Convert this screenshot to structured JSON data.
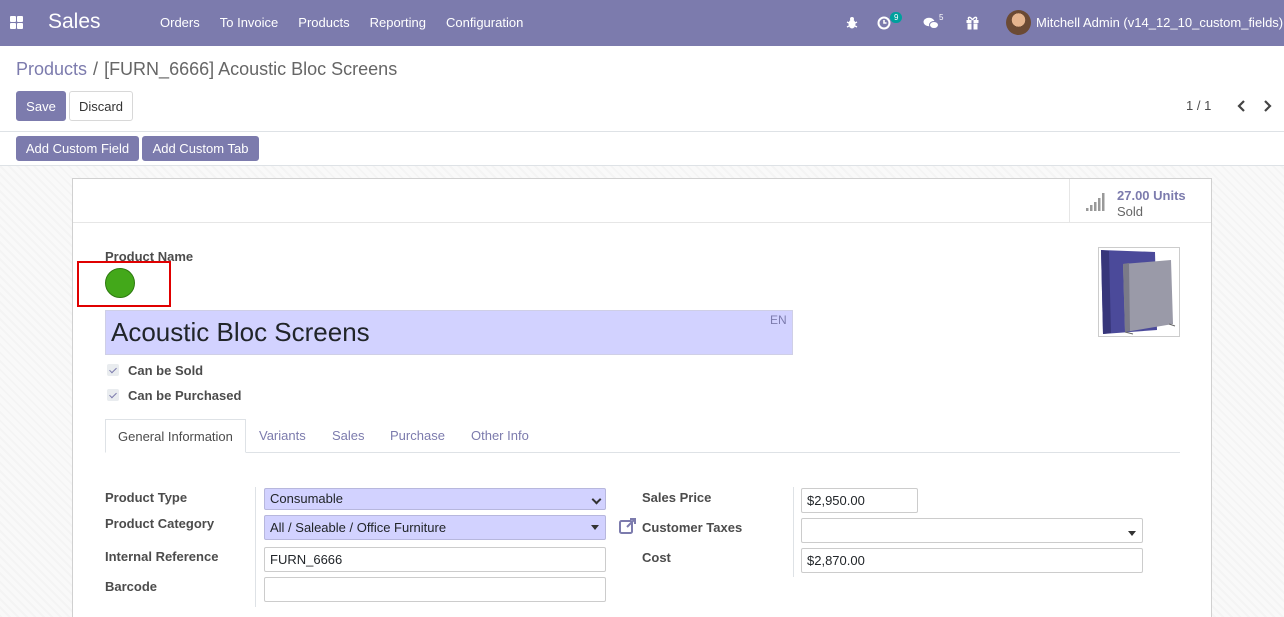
{
  "navbar": {
    "app_name": "Sales",
    "menu": [
      "Orders",
      "To Invoice",
      "Products",
      "Reporting",
      "Configuration"
    ],
    "activity_count": "9",
    "messages_count": "5",
    "user_label": "Mitchell Admin (v14_12_10_custom_fields)"
  },
  "breadcrumb": {
    "parent": "Products",
    "separator": "/",
    "current": "[FURN_6666] Acoustic Bloc Screens"
  },
  "actions": {
    "save": "Save",
    "discard": "Discard",
    "add_custom_field": "Add Custom Field",
    "add_custom_tab": "Add Custom Tab"
  },
  "pager": {
    "value": "1 / 1"
  },
  "stat": {
    "value": "27.00 Units",
    "label": "Sold"
  },
  "form": {
    "product_name_label": "Product Name",
    "product_name": "Acoustic Bloc Screens",
    "lang": "EN",
    "can_be_sold": "Can be Sold",
    "can_be_purchased": "Can be Purchased",
    "status_color": "#43a81a"
  },
  "tabs": [
    {
      "label": "General Information",
      "active": true
    },
    {
      "label": "Variants"
    },
    {
      "label": "Sales"
    },
    {
      "label": "Purchase"
    },
    {
      "label": "Other Info"
    }
  ],
  "fields": {
    "product_type": {
      "label": "Product Type",
      "value": "Consumable"
    },
    "product_category": {
      "label": "Product Category",
      "value": "All / Saleable / Office Furniture"
    },
    "internal_reference": {
      "label": "Internal Reference",
      "value": "FURN_6666"
    },
    "barcode": {
      "label": "Barcode",
      "value": ""
    },
    "sales_price": {
      "label": "Sales Price",
      "value": "$2,950.00"
    },
    "customer_taxes": {
      "label": "Customer Taxes",
      "value": ""
    },
    "cost": {
      "label": "Cost",
      "value": "$2,870.00"
    }
  },
  "colors": {
    "brand": "#7c7bad",
    "selected_field_bg": "#d2d2ff",
    "highlight": "#e00000"
  }
}
